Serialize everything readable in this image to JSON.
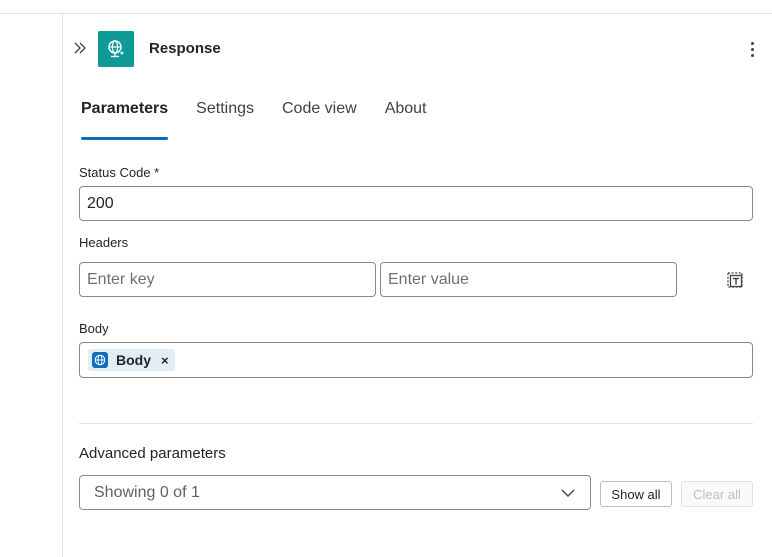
{
  "header": {
    "title": "Response",
    "icons": {
      "collapse": "double-chevron-right-icon",
      "app": "globe-connector-icon",
      "more": "more-vertical-icon"
    },
    "accent_color": "#0f9a9a"
  },
  "tabs": [
    {
      "label": "Parameters",
      "active": true
    },
    {
      "label": "Settings",
      "active": false
    },
    {
      "label": "Code view",
      "active": false
    },
    {
      "label": "About",
      "active": false
    }
  ],
  "form": {
    "status_code": {
      "label": "Status Code *",
      "value": "200"
    },
    "headers": {
      "label": "Headers",
      "key_placeholder": "Enter key",
      "value_placeholder": "Enter value",
      "delete_icon": "delete-row-icon"
    },
    "body": {
      "label": "Body",
      "token": {
        "label": "Body",
        "icon": "globe-icon",
        "remove": "×"
      }
    }
  },
  "advanced": {
    "label": "Advanced parameters",
    "dropdown_value": "Showing 0 of 1",
    "show_all_label": "Show all",
    "clear_all_label": "Clear all"
  },
  "colors": {
    "tab_underline": "#0f6cbd",
    "token_bg": "#e1eef8"
  }
}
